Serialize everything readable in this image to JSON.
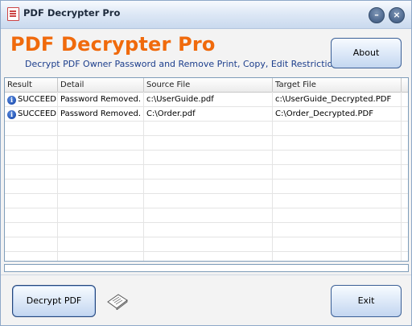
{
  "window": {
    "title": "PDF Decrypter Pro",
    "minimize_glyph": "–",
    "close_glyph": "×"
  },
  "header": {
    "app_title": "PDF Decrypter Pro",
    "subtitle": "Decrypt PDF Owner Password and Remove Print, Copy, Edit  Restrictions.",
    "about_label": "About"
  },
  "table": {
    "columns": [
      "Result",
      "Detail",
      "Source File",
      "Target File"
    ],
    "rows": [
      {
        "icon": "info-icon",
        "result": "SUCCEED",
        "detail": "Password Removed.",
        "source": "c:\\UserGuide.pdf",
        "target": "c:\\UserGuide_Decrypted.PDF"
      },
      {
        "icon": "info-icon",
        "result": "SUCCEED",
        "detail": "Password Removed.",
        "source": "C:\\Order.pdf",
        "target": "C:\\Order_Decrypted.PDF"
      }
    ]
  },
  "progress": {
    "value": 0
  },
  "footer": {
    "decrypt_label": "Decrypt PDF",
    "exit_label": "Exit",
    "doc_icon": "pdf-document-icon"
  },
  "colors": {
    "title_orange": "#f06a0c",
    "subtitle_blue": "#1c3e8c",
    "button_border": "#3a5f96",
    "info_icon_blue": "#1f4fb0"
  }
}
